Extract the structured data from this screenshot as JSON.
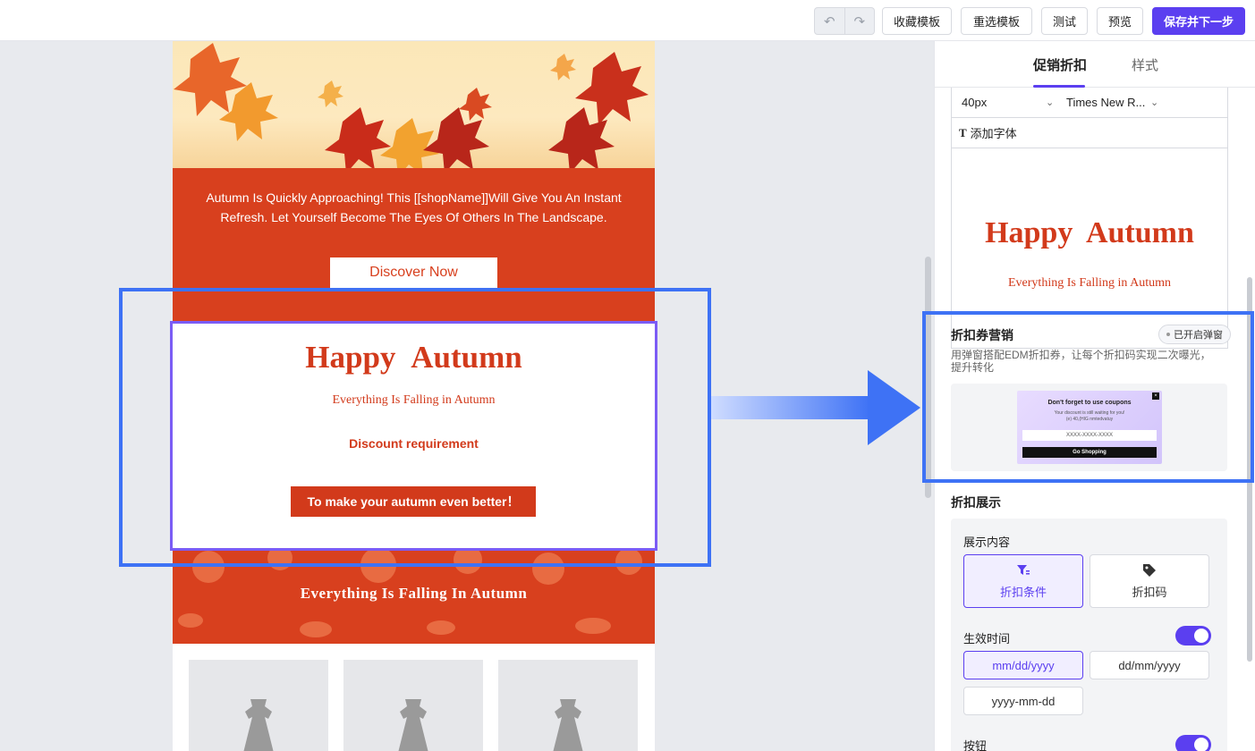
{
  "toolbar": {
    "undo_icon": "undo-icon",
    "redo_icon": "redo-icon",
    "favorite_template": "收藏模板",
    "reselect_template": "重选模板",
    "test": "测试",
    "preview": "预览",
    "save_next": "保存并下一步",
    "accent_color": "#5b3ff0"
  },
  "email": {
    "intro_text": "Autumn Is Quickly Approaching! This [[shopName]]Will Give You An Instant Refresh. Let Yourself Become The Eyes Of Others In The Landscape.",
    "discover_button": "Discover Now",
    "happy_title": "Happy  Autumn",
    "falling_subtitle": "Everything Is Falling in Autumn",
    "discount_requirement": "Discount requirement",
    "autumn_button": "To make your autumn even better！",
    "band_text": "Everything Is Falling In Autumn",
    "brand_orange": "#d8401e"
  },
  "panel": {
    "tabs": [
      {
        "label": "促销折扣",
        "active": true
      },
      {
        "label": "样式",
        "active": false
      }
    ],
    "font_size": "40px",
    "font_family": "Times New R...",
    "add_font": "添加字体",
    "preview_title": "Happy  Autumn",
    "preview_subtitle": "Everything Is Falling in Autumn",
    "coupon": {
      "title": "折扣券营销",
      "badge": "已开启弹窗",
      "description": "用弹窗搭配EDM折扣券，让每个折扣码实现二次曝光，提升转化",
      "popup_title": "Don't forget to use coupons",
      "popup_line1": "Your discount is still waiting for you!",
      "popup_line2": "(e) 40,(HIG nmtedvatuy",
      "popup_code": "XXXX-XXXX-XXXX",
      "popup_button": "Go Shopping"
    },
    "discount_display": {
      "title": "折扣展示",
      "content_label": "展示内容",
      "options": [
        {
          "label": "折扣条件",
          "icon": "filter-icon",
          "active": true
        },
        {
          "label": "折扣码",
          "icon": "tag-icon",
          "active": false
        }
      ],
      "effective_time_label": "生效时间",
      "date_formats": [
        "mm/dd/yyyy",
        "dd/mm/yyyy",
        "yyyy-mm-dd"
      ],
      "button_label": "按钮"
    }
  }
}
